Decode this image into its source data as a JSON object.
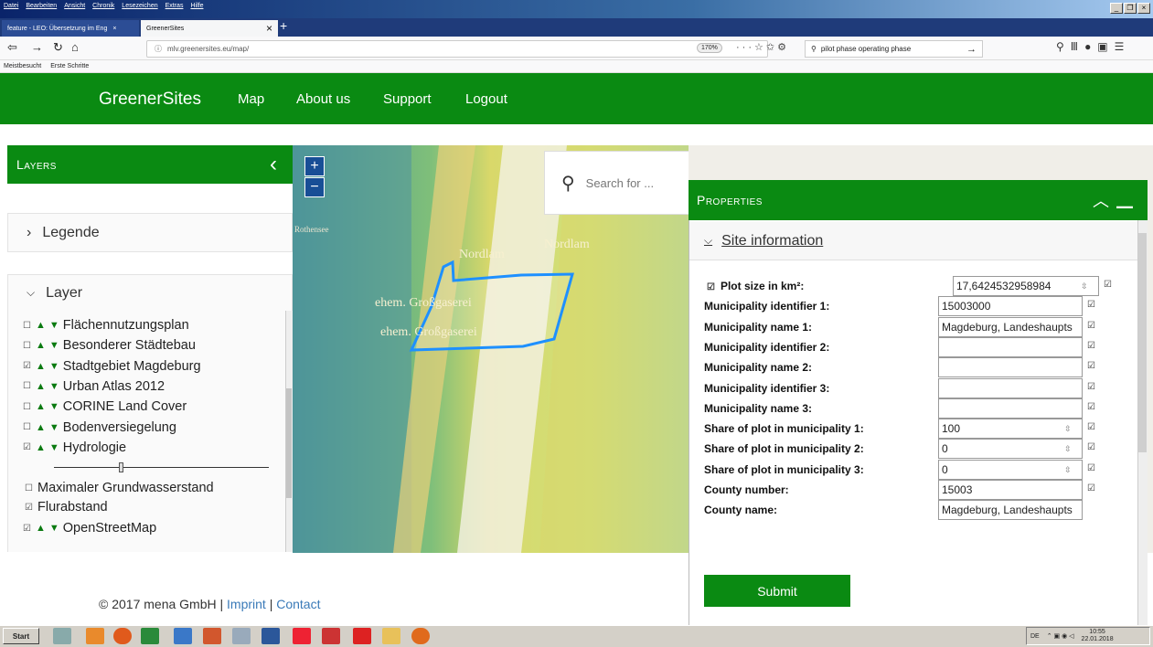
{
  "browser": {
    "menu": [
      "Datei",
      "Bearbeiten",
      "Ansicht",
      "Chronik",
      "Lesezeichen",
      "Extras",
      "Hilfe"
    ],
    "tabs": [
      {
        "label": "feature - LEO: Übersetzung im Eng"
      },
      {
        "label": "GreenerSites"
      }
    ],
    "url": "mlv.greenersites.eu/map/",
    "zoom": "170%",
    "search": "pilot phase operating phase",
    "bookmarks": [
      "Meistbesucht",
      "Erste Schritte"
    ]
  },
  "site": {
    "brand": "GreenerSites",
    "nav": [
      "Map",
      "About us",
      "Support",
      "Logout"
    ]
  },
  "layers_panel": {
    "title": "Layers",
    "legende": "Legende",
    "layer_section": "Layer",
    "items": [
      {
        "label": "Flächennutzungsplan",
        "checked": false
      },
      {
        "label": "Besonderer Städtebau",
        "checked": false
      },
      {
        "label": "Stadtgebiet Magdeburg",
        "checked": true
      },
      {
        "label": "Urban Atlas 2012",
        "checked": false
      },
      {
        "label": "CORINE Land Cover",
        "checked": false
      },
      {
        "label": "Bodenversiegelung",
        "checked": false
      },
      {
        "label": "Hydrologie",
        "checked": true
      }
    ],
    "sublayers": [
      {
        "label": "Maximaler Grundwasserstand",
        "checked": false
      },
      {
        "label": "Flurabstand",
        "checked": true
      }
    ],
    "osm": {
      "label": "OpenStreetMap",
      "checked": true
    },
    "opacity_slider": 0.3
  },
  "map": {
    "search_placeholder": "Search for ...",
    "labels": [
      "Rothensee",
      "Nordlam",
      "Nordlam",
      "ehem. Großgaserei",
      "ehem. Großgaserei"
    ]
  },
  "properties": {
    "title": "Properties",
    "section": "Site information",
    "rows": [
      {
        "label": "Plot size in km²:",
        "value": "17,6424532958984"
      },
      {
        "label": "Municipality identifier 1:",
        "value": "15003000"
      },
      {
        "label": "Municipality name 1:",
        "value": "Magdeburg, Landeshaupts"
      },
      {
        "label": "Municipality identifier 2:",
        "value": ""
      },
      {
        "label": "Municipality name 2:",
        "value": ""
      },
      {
        "label": "Municipality identifier 3:",
        "value": ""
      },
      {
        "label": "Municipality name 3:",
        "value": ""
      },
      {
        "label": "Share of plot in municipality 1:",
        "value": "100"
      },
      {
        "label": "Share of plot in municipality 2:",
        "value": "0"
      },
      {
        "label": "Share of plot in municipality 3:",
        "value": "0"
      },
      {
        "label": "County number:",
        "value": "15003"
      },
      {
        "label": "County name:",
        "value": "Magdeburg, Landeshaupts"
      }
    ],
    "submit": "Submit"
  },
  "footer": {
    "copyright": "© 2017 mena GmbH | ",
    "imprint": "Imprint",
    "sep": " | ",
    "contact": "Contact"
  },
  "taskbar": {
    "start": "Start",
    "lang": "DE",
    "time": "10:55",
    "date": "22.01.2018"
  },
  "colors": {
    "brand_green": "#0a8a12",
    "link": "#3a7ab8"
  }
}
